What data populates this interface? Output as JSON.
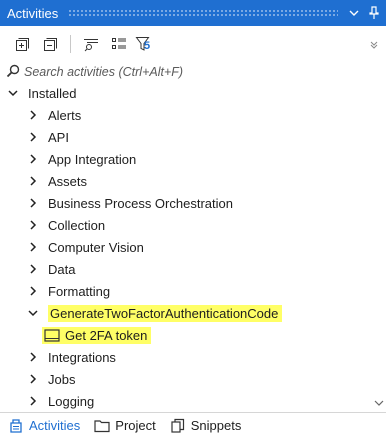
{
  "panel": {
    "title": "Activities"
  },
  "search": {
    "placeholder": "Search activities (Ctrl+Alt+F)"
  },
  "toolbar": {
    "filter_count": "5"
  },
  "tree": {
    "root": "Installed",
    "items": [
      {
        "label": "Alerts"
      },
      {
        "label": "API"
      },
      {
        "label": "App Integration"
      },
      {
        "label": "Assets"
      },
      {
        "label": "Business Process Orchestration"
      },
      {
        "label": "Collection"
      },
      {
        "label": "Computer Vision"
      },
      {
        "label": "Data"
      },
      {
        "label": "Formatting"
      },
      {
        "label": "GenerateTwoFactorAuthenticationCode",
        "child": "Get 2FA token"
      },
      {
        "label": "Integrations"
      },
      {
        "label": "Jobs"
      },
      {
        "label": "Logging"
      }
    ]
  },
  "tabs": [
    {
      "label": "Activities"
    },
    {
      "label": "Project"
    },
    {
      "label": "Snippets"
    }
  ],
  "colors": {
    "accent": "#1f6fd1",
    "highlight": "#ffff66"
  }
}
